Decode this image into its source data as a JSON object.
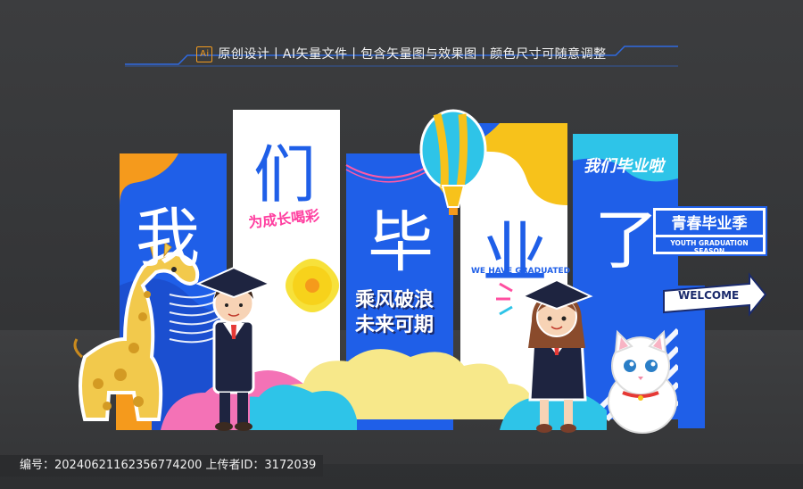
{
  "header": {
    "ai_badge": "Ai",
    "tagline": "原创设计丨AI矢量文件丨包含矢量图与效果图丨颜色尺寸可随意调整"
  },
  "panels": {
    "wo": "我",
    "men": "们",
    "bi": "毕",
    "ye": "业",
    "le": "了"
  },
  "slogans": {
    "growth": "为成长喝彩",
    "ride_wind_1": "乘风破浪",
    "ride_wind_2": "未来可期",
    "we_have_graduated": "WE HAVE GRADUATED",
    "women_biye": "我们毕业啦"
  },
  "sign": {
    "title": "青春毕业季",
    "subtitle": "YOUTH GRADUATION SEASON",
    "welcome": "WELCOME"
  },
  "footer": {
    "text": "编号：20240621162356774200  上传者ID：3172039"
  },
  "colors": {
    "blue": "#1f5fe8",
    "yellow": "#f7c21b",
    "orange": "#f59a1c",
    "pink": "#f472b6",
    "cyan": "#2ec4e8",
    "white": "#ffffff",
    "navy": "#1a2a6c"
  }
}
